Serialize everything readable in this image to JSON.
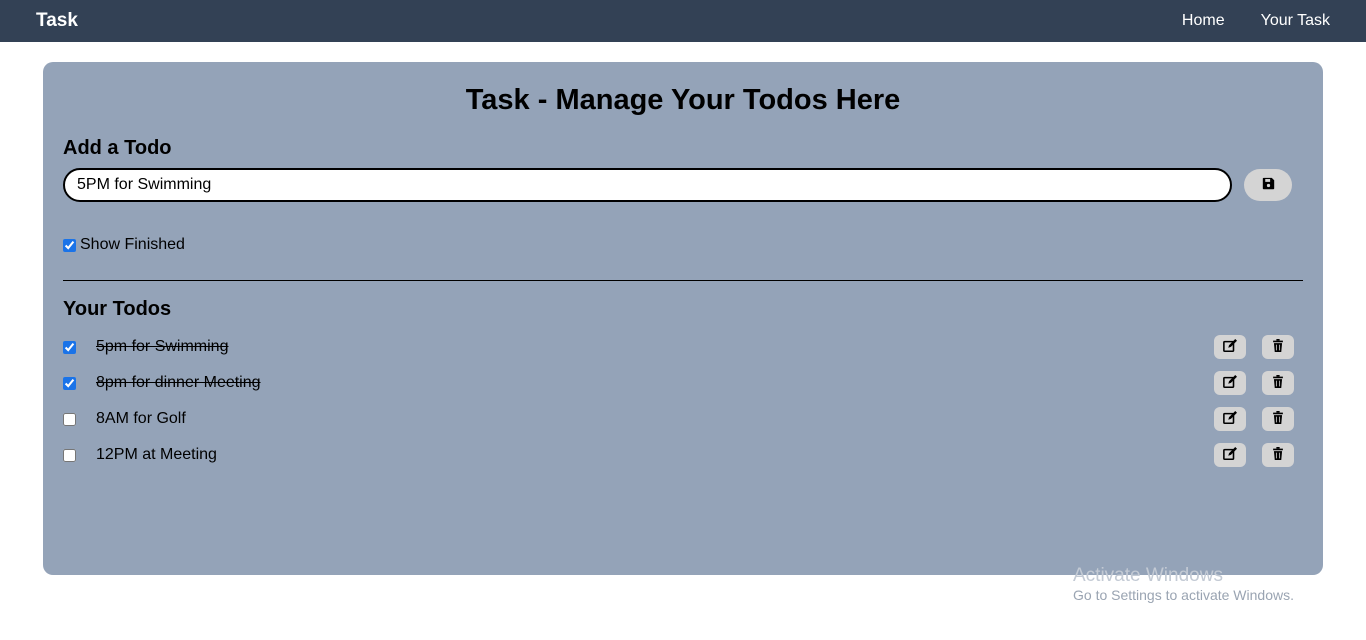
{
  "navbar": {
    "brand": "Task",
    "links": [
      {
        "label": "Home"
      },
      {
        "label": "Your Task"
      }
    ]
  },
  "main": {
    "title": "Task - Manage Your Todos Here",
    "add_heading": "Add a Todo",
    "input_value": "5PM for Swimming",
    "save_icon": "save-icon",
    "show_finished_label": "Show Finished",
    "show_finished_checked": true,
    "todos_heading": "Your Todos",
    "todos": [
      {
        "text": "5pm for Swimming",
        "done": true
      },
      {
        "text": "8pm for dinner Meeting",
        "done": true
      },
      {
        "text": "8AM for Golf",
        "done": false
      },
      {
        "text": "12PM at Meeting",
        "done": false
      }
    ],
    "edit_icon": "edit-icon",
    "delete_icon": "trash-icon"
  },
  "watermark": {
    "title": "Activate Windows",
    "subtitle": "Go to Settings to activate Windows."
  },
  "colors": {
    "navbar": "#334155",
    "card": "#94a3b8",
    "button": "#d4d4d4"
  }
}
